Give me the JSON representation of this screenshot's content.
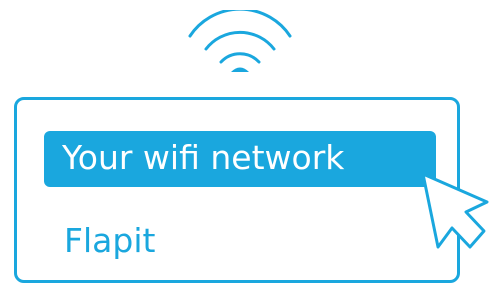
{
  "wifi_icon": {
    "name": "wifi-icon",
    "color": "#1aa7de"
  },
  "network_list": {
    "options": [
      {
        "label": "Your wifi network",
        "selected": true
      },
      {
        "label": "Flapit",
        "selected": false
      }
    ],
    "accent_color": "#1aa7de",
    "selected_text_color": "#ffffff"
  },
  "cursor_icon": {
    "name": "pointer-cursor-icon",
    "color": "#1aa7de"
  }
}
